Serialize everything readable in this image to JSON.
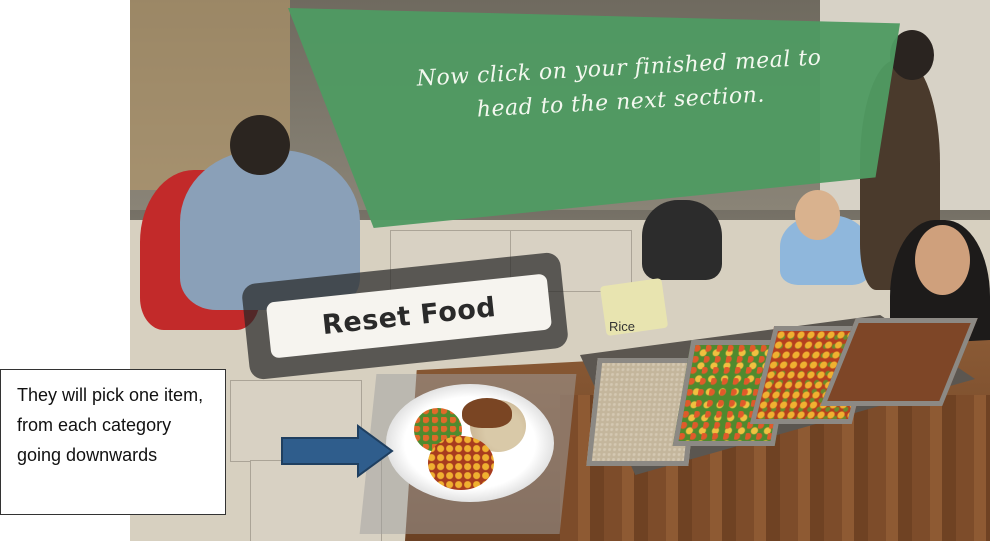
{
  "scene": {
    "instruction_text": "Now click on your finished meal to head to the next section.",
    "reset_button_label": "Reset Food",
    "rice_sign_label": "Rice"
  },
  "annotation": {
    "text": "They will pick one item, from each category going downwards"
  },
  "colors": {
    "panel_green": "#4f9a62",
    "arrow_blue": "#2f5d8c",
    "counter_wood": "#7d4c2a"
  },
  "icons": {
    "arrow": "arrow-right-icon"
  }
}
